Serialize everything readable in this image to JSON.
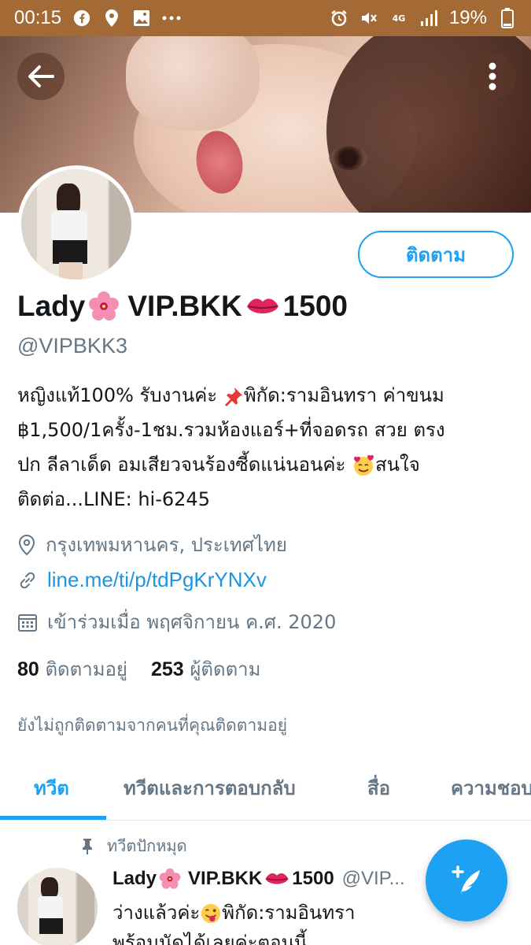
{
  "status_bar": {
    "time": "00:15",
    "battery": "19%",
    "network": "4G",
    "notification_icons": [
      "facebook-icon",
      "location-icon",
      "image-icon",
      "more-dots-icon"
    ],
    "system_icons": [
      "alarm-icon",
      "mute-icon",
      "network-icon",
      "signal-icon",
      "battery-icon"
    ]
  },
  "profile": {
    "name_part1": "Lady",
    "name_part2": "VIP.BKK",
    "name_part3": "1500",
    "handle": "@VIPBKK3",
    "follow_label": "ติดตาม",
    "bio_lines": [
      "หญิงแท้100% รับงานค่ะ ",
      "พิกัด:รามอินทรา ค่าขนม",
      "฿1,500/1ครั้ง-1ชม.รวมห้องแอร์+ที่จอดรถ สวย ตรง",
      "ปก ลีลาเด็ด อมเสียวจนร้องซี้ดแน่นอนค่ะ ",
      "สนใจ",
      "ติดต่อ...LINE: hi-6245"
    ],
    "location": "กรุงเทพมหานคร, ประเทศไทย",
    "link": "line.me/ti/p/tdPgKrYNXv",
    "joined": "เข้าร่วมเมื่อ พฤศจิกายน ค.ศ. 2020",
    "following_count": "80",
    "following_label": "ติดตามอยู่",
    "followers_count": "253",
    "followers_label": "ผู้ติดตาม",
    "not_followed_note": "ยังไม่ถูกติดตามจากคนที่คุณติดตามอยู่"
  },
  "tabs": [
    {
      "label": "ทวีต",
      "active": true
    },
    {
      "label": "ทวีตและการตอบกลับ",
      "active": false
    },
    {
      "label": "สื่อ",
      "active": false
    },
    {
      "label": "ความชอบ",
      "active": false
    }
  ],
  "pinned_tweet": {
    "pinned_label": "ทวีตปักหมุด",
    "name_part1": "Lady",
    "name_part2": "VIP.BKK",
    "name_part3": "1500",
    "handle": "@VIP...",
    "text_line1_a": "ว่างแล้วค่ะ",
    "text_line1_b": "พิกัด:รามอินทรา",
    "text_line2": "พร้อมนัดได้เลยค่ะตอนนี้"
  },
  "colors": {
    "accent": "#1da1f2",
    "status_bar": "#a46a35",
    "secondary_text": "#657786"
  }
}
